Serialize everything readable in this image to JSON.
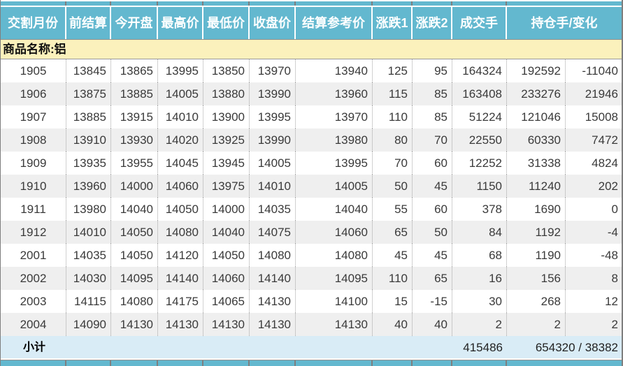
{
  "colors": {
    "header_teal": "#63b8cf",
    "header_text": "#ffffff",
    "product_yellow": "#fbf1bc",
    "subtotal_blue": "#d9ecf6",
    "alt_row_gray": "#efefef",
    "border_gray": "#7f7f7f",
    "dotted_line": "#a3a3a3",
    "data_text": "#3a3a3a"
  },
  "table": {
    "headers": [
      "交割月份",
      "前结算",
      "今开盘",
      "最高价",
      "最低价",
      "收盘价",
      "结算参考价",
      "涨跌1",
      "涨跌2",
      "成交手",
      "持仓手/变化"
    ],
    "product_label": "商品名称:铝",
    "rows": [
      [
        "1905",
        "13845",
        "13865",
        "13995",
        "13850",
        "13970",
        "13940",
        "125",
        "95",
        "164324",
        "192592",
        "-11040"
      ],
      [
        "1906",
        "13875",
        "13885",
        "14005",
        "13880",
        "13990",
        "13960",
        "115",
        "85",
        "163408",
        "233276",
        "21946"
      ],
      [
        "1907",
        "13885",
        "13915",
        "14010",
        "13900",
        "13995",
        "13970",
        "110",
        "85",
        "51224",
        "121046",
        "15008"
      ],
      [
        "1908",
        "13910",
        "13930",
        "14020",
        "13925",
        "13990",
        "13980",
        "80",
        "70",
        "22550",
        "60330",
        "7472"
      ],
      [
        "1909",
        "13935",
        "13955",
        "14045",
        "13945",
        "14005",
        "13995",
        "70",
        "60",
        "12252",
        "31338",
        "4824"
      ],
      [
        "1910",
        "13960",
        "14000",
        "14060",
        "13975",
        "14010",
        "14005",
        "50",
        "45",
        "1150",
        "11240",
        "202"
      ],
      [
        "1911",
        "13980",
        "14040",
        "14050",
        "14000",
        "14035",
        "14040",
        "55",
        "60",
        "378",
        "1690",
        "0"
      ],
      [
        "1912",
        "14010",
        "14050",
        "14080",
        "14040",
        "14075",
        "14060",
        "65",
        "50",
        "84",
        "1192",
        "-4"
      ],
      [
        "2001",
        "14035",
        "14050",
        "14120",
        "14050",
        "14080",
        "14080",
        "45",
        "45",
        "68",
        "1190",
        "-48"
      ],
      [
        "2002",
        "14030",
        "14095",
        "14140",
        "14060",
        "14140",
        "14095",
        "110",
        "65",
        "16",
        "156",
        "8"
      ],
      [
        "2003",
        "14115",
        "14080",
        "14175",
        "14065",
        "14130",
        "14100",
        "15",
        "-15",
        "30",
        "268",
        "12"
      ],
      [
        "2004",
        "14090",
        "14130",
        "14130",
        "14130",
        "14130",
        "14130",
        "40",
        "40",
        "2",
        "2",
        "2"
      ]
    ],
    "subtotal": {
      "label": "小计",
      "volume_total": "415486",
      "open_interest_total": "654320 / 38382"
    }
  }
}
